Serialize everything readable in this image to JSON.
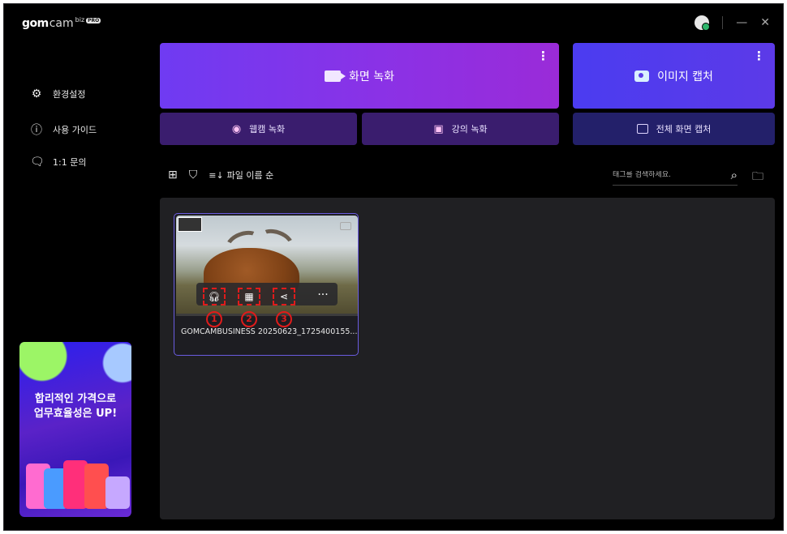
{
  "app": {
    "logo_gom": "gom",
    "logo_cam": "cam",
    "logo_biz": "biz",
    "logo_badge": "PRO"
  },
  "window_controls": {
    "minimize": "—",
    "close": "✕"
  },
  "sidebar": {
    "items": [
      {
        "label": "환경설정",
        "icon": "gear-icon"
      },
      {
        "label": "사용 가이드",
        "icon": "info-icon"
      },
      {
        "label": "1:1 문의",
        "icon": "chat-icon"
      }
    ],
    "promo": {
      "line1": "합리적인 가격으로",
      "line2": "업무효율성은 UP!"
    }
  },
  "actions": {
    "screen_record": "화면 녹화",
    "image_capture": "이미지 캡처",
    "webcam_record": "웹캠 녹화",
    "lecture_record": "강의 녹화",
    "full_screen_capture": "전체 화면 캡처",
    "more": "⋮"
  },
  "toolbar": {
    "sort_label": "파일 이름 순",
    "search_placeholder": "태그를 검색하세요."
  },
  "files": [
    {
      "name": "GOMCAMBUSINESS 20250623_1725400155...",
      "annotations": [
        "1",
        "2",
        "3"
      ]
    }
  ],
  "colors": {
    "record_gradient": "#7a36ee",
    "capture_gradient": "#5038ec",
    "sub_button": "#3a1d6e",
    "full_capture": "#23206a",
    "annotation_red": "#e01b1b",
    "card_border": "#6a5ce0"
  }
}
